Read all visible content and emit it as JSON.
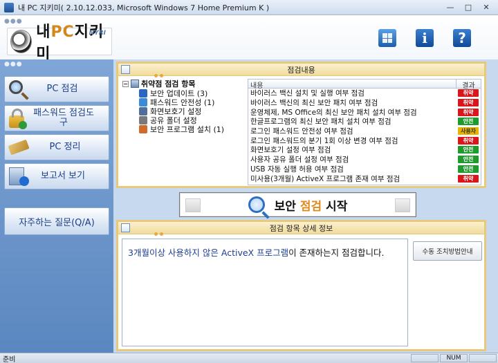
{
  "window": {
    "title": "내 PC 지키미( 2.10.12.033, Microsoft Windows 7 Home Premium K  )",
    "minimize": "—",
    "maximize": "□",
    "close": "✕"
  },
  "header": {
    "brand_prefix": "내",
    "brand_pc": "PC",
    "brand_suffix": "지키미",
    "brand_tag": "NYRI"
  },
  "sidebar": {
    "items": [
      {
        "label": "PC 점검",
        "icon": "magnifier-icon"
      },
      {
        "label": "패스워드 점검도구",
        "icon": "lock-icon"
      },
      {
        "label": "PC 정리",
        "icon": "broom-icon"
      },
      {
        "label": "보고서 보기",
        "icon": "report-icon"
      }
    ],
    "faq": "자주하는 질문(Q/A)"
  },
  "check_panel": {
    "title": "점검내용",
    "tree": {
      "root": "취약점 점검 항목",
      "nodes": [
        {
          "label": "보안 업데이트 (3)",
          "color": "#2a66c4"
        },
        {
          "label": "패스워드 안전성 (1)",
          "color": "#3c8bd8"
        },
        {
          "label": "화면보호기 설정",
          "color": "#4f6f9c"
        },
        {
          "label": "공유 폴더 설정",
          "color": "#7a7a7a"
        },
        {
          "label": "보안 프로그램 설치 (1)",
          "color": "#d06b2a"
        }
      ]
    },
    "table": {
      "col_content": "내용",
      "col_result": "결과",
      "rows": [
        {
          "content": "바이러스 백신 설치 및 실행 여부 점검",
          "result": "취약",
          "status": "vuln"
        },
        {
          "content": "바이러스 백신의 최신 보안 패치 여부 점검",
          "result": "취약",
          "status": "vuln"
        },
        {
          "content": "운영체제, MS Office의 최신 보안 패치 설치 여부 점검",
          "result": "취약",
          "status": "vuln"
        },
        {
          "content": "한글프로그램의 최신 보안 패치 설치 여부 점검",
          "result": "안전",
          "status": "safe"
        },
        {
          "content": "로그인 패스워드 안전성 여부 점검",
          "result": "사용자",
          "status": "user"
        },
        {
          "content": "로그인 패스워드의 분기 1회 이상 변경 여부 점검",
          "result": "취약",
          "status": "vuln"
        },
        {
          "content": "화면보호기 설정 여부 점검",
          "result": "안전",
          "status": "safe"
        },
        {
          "content": "사용자 공유 폴더 설정 여부 점검",
          "result": "안전",
          "status": "safe"
        },
        {
          "content": "USB 자동 실행 허용 여부 점검",
          "result": "안전",
          "status": "safe"
        },
        {
          "content": "미사용(3개월) ActiveX 프로그램 존재 여부 점검",
          "result": "취약",
          "status": "vuln"
        }
      ]
    }
  },
  "start_button": {
    "pre": "보안 ",
    "highlight": "점검",
    "post": " 시작"
  },
  "detail_panel": {
    "title": "점검 항목 상세 정보",
    "text_highlight": "3개월이상 사용하지 않은 ActiveX 프로그램",
    "text_rest": "이 존재하는지 점검합니다.",
    "guide_button": "수동 조치방법안내"
  },
  "statusbar": {
    "status": "준비",
    "num": "NUM"
  },
  "colors": {
    "vuln": "#d8161b",
    "safe": "#1f9a2c",
    "user": "#e7b400",
    "accent": "#e08a1e"
  }
}
